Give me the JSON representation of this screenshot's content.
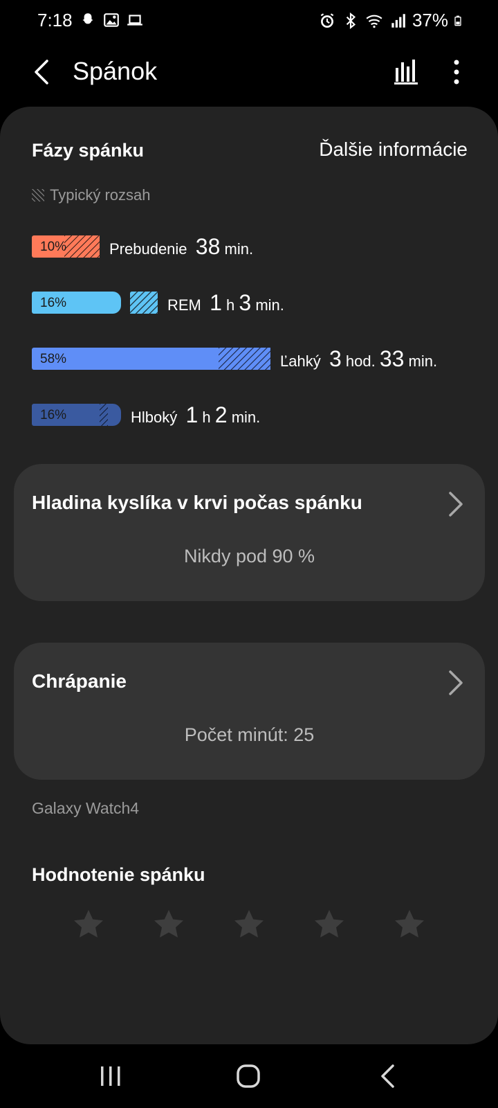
{
  "status_bar": {
    "time": "7:18",
    "battery": "37%",
    "icons_left": [
      "snapchat-icon",
      "gallery-icon",
      "laptop-icon"
    ],
    "icons_right": [
      "alarm-icon",
      "bluetooth-icon",
      "wifi-icon",
      "signal-icon",
      "battery-icon"
    ]
  },
  "app_bar": {
    "title": "Spánok",
    "back_icon": "back-arrow-icon",
    "chart_icon": "bar-chart-icon",
    "more_icon": "more-vertical-icon"
  },
  "sleep_stages": {
    "title": "Fázy spánku",
    "more_info": "Ďalšie informácie",
    "legend": "Typický rozsah",
    "stages": [
      {
        "name": "Prebudenie",
        "percent": "10%",
        "value": 10,
        "color": "#ff7a59",
        "time": [
          {
            "num": "38",
            "unit": "min."
          }
        ]
      },
      {
        "name": "REM",
        "percent": "16%",
        "value": 16,
        "color": "#5ec4f5",
        "time": [
          {
            "num": "1",
            "unit": "h"
          },
          {
            "num": "3",
            "unit": "min."
          }
        ]
      },
      {
        "name": "Ľahký",
        "percent": "58%",
        "value": 58,
        "color": "#5f8ef7",
        "time": [
          {
            "num": "3",
            "unit": "hod."
          },
          {
            "num": "33",
            "unit": "min."
          }
        ]
      },
      {
        "name": "Hlboký",
        "percent": "16%",
        "value": 16,
        "color": "#3a5aa0",
        "time": [
          {
            "num": "1",
            "unit": "h"
          },
          {
            "num": "2",
            "unit": "min."
          }
        ]
      }
    ]
  },
  "oxygen": {
    "title": "Hladina kyslíka v krvi počas spánku",
    "value": "Nikdy pod 90 %"
  },
  "snoring": {
    "title": "Chrápanie",
    "value": "Počet minút: 25"
  },
  "device": "Galaxy Watch4",
  "rating": {
    "title": "Hodnotenie spánku",
    "stars_total": 5,
    "stars_selected": 0
  },
  "nav_bar": {
    "icons": [
      "recents-icon",
      "home-icon",
      "back-icon"
    ]
  }
}
